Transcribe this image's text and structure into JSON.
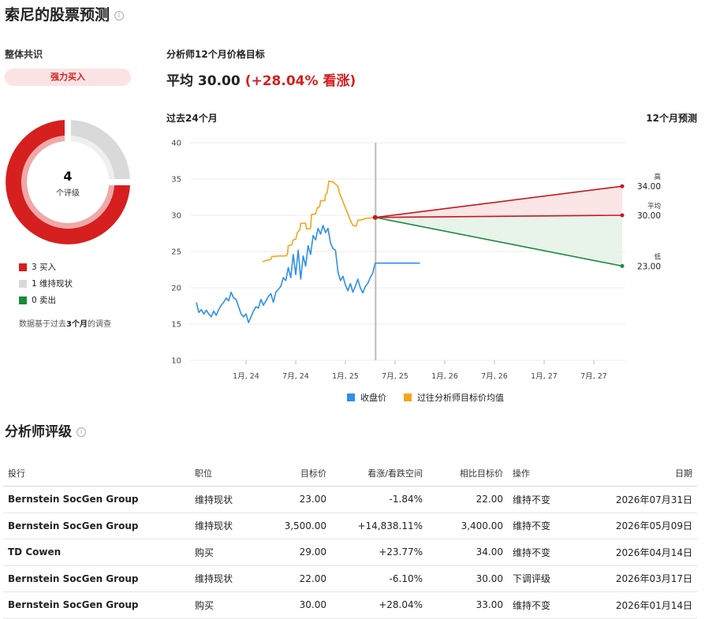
{
  "page": {
    "title": "索尼的股票预测"
  },
  "consensus": {
    "label": "整体共识",
    "badge": "强力买入",
    "total": "4",
    "total_label": "个评级",
    "legend": [
      {
        "label": "3 买入",
        "color": "#d61f1f"
      },
      {
        "label": "1 维持现状",
        "color": "#d9d9d9"
      },
      {
        "label": "0 卖出",
        "color": "#1a8a3a"
      }
    ],
    "note_prefix": "数据基于过去",
    "note_bold": "3个月",
    "note_suffix": "的调查"
  },
  "target": {
    "label": "分析师12个月价格目标",
    "avg_text": "平均 30.00",
    "avg_pct": "(+28.04% 看涨)",
    "past_label": "过去24个月",
    "future_label": "12个月预测"
  },
  "chart_data": {
    "type": "line",
    "ylim": [
      10,
      40
    ],
    "yticks": [
      10,
      15,
      20,
      25,
      30,
      35,
      40
    ],
    "xticks": [
      "1月, 24",
      "7月, 24",
      "1月, 25",
      "7月, 25",
      "1月, 26",
      "7月, 26",
      "1月, 27",
      "7月, 27"
    ],
    "legend": [
      {
        "name": "收盘价",
        "color": "#2f8fe8"
      },
      {
        "name": "过往分析师目标价均值",
        "color": "#f4a51c"
      }
    ],
    "forecast": {
      "start": 29.7,
      "high": {
        "label": "高",
        "value": "34.00",
        "num": 34.0
      },
      "avg": {
        "label": "平均",
        "value": "30.00",
        "num": 30.0
      },
      "low": {
        "label": "低",
        "value": "23.00",
        "num": 23.0
      },
      "colors": {
        "high": "#c8161e",
        "avg": "#c8161e",
        "low": "#1a8a3a"
      }
    },
    "series": [
      {
        "name": "收盘价",
        "points": [
          [
            0,
            18
          ],
          [
            0.3,
            16.6
          ],
          [
            0.6,
            17.0
          ],
          [
            0.9,
            16.4
          ],
          [
            1.2,
            16.9
          ],
          [
            1.5,
            16.4
          ],
          [
            1.8,
            16.0
          ],
          [
            2.1,
            16.8
          ],
          [
            2.4,
            16.2
          ],
          [
            2.7,
            17.0
          ],
          [
            3.0,
            17.6
          ],
          [
            3.3,
            18.0
          ],
          [
            3.6,
            18.6
          ],
          [
            3.9,
            18.2
          ],
          [
            4.2,
            19.4
          ],
          [
            4.5,
            18.6
          ],
          [
            4.8,
            18.4
          ],
          [
            5.1,
            17.4
          ],
          [
            5.4,
            16.4
          ],
          [
            5.7,
            16.0
          ],
          [
            6.0,
            16.4
          ],
          [
            6.3,
            15.2
          ],
          [
            6.6,
            16.0
          ],
          [
            6.9,
            16.8
          ],
          [
            7.2,
            17.4
          ],
          [
            7.5,
            17.2
          ],
          [
            7.8,
            18.4
          ],
          [
            8.1,
            17.6
          ],
          [
            8.4,
            18.2
          ],
          [
            8.7,
            18.8
          ],
          [
            9.0,
            19.2
          ],
          [
            9.3,
            18.0
          ],
          [
            9.6,
            19.4
          ],
          [
            9.9,
            19.8
          ],
          [
            10.2,
            20.2
          ],
          [
            10.5,
            21.4
          ],
          [
            10.8,
            21.0
          ],
          [
            11.1,
            22.8
          ],
          [
            11.4,
            21.4
          ],
          [
            11.7,
            24.6
          ],
          [
            12.0,
            21.8
          ],
          [
            12.3,
            25.2
          ],
          [
            12.6,
            21.2
          ],
          [
            12.9,
            24.4
          ],
          [
            13.2,
            23.0
          ],
          [
            13.5,
            25.8
          ],
          [
            13.8,
            24.6
          ],
          [
            14.1,
            27.2
          ],
          [
            14.4,
            26.6
          ],
          [
            14.7,
            28.2
          ],
          [
            15.0,
            27.4
          ],
          [
            15.3,
            28.6
          ],
          [
            15.6,
            27.6
          ],
          [
            15.9,
            28.2
          ],
          [
            16.2,
            26.2
          ],
          [
            16.5,
            25.4
          ],
          [
            16.8,
            25.2
          ],
          [
            17.1,
            22.2
          ],
          [
            17.4,
            21.0
          ],
          [
            17.7,
            21.6
          ],
          [
            18.0,
            20.4
          ],
          [
            18.3,
            19.6
          ],
          [
            18.6,
            20.6
          ],
          [
            18.9,
            19.4
          ],
          [
            19.2,
            20.2
          ],
          [
            19.5,
            21.2
          ],
          [
            19.8,
            20.0
          ],
          [
            20.1,
            19.3
          ],
          [
            20.4,
            20.2
          ],
          [
            20.7,
            20.6
          ],
          [
            21.0,
            21.4
          ],
          [
            21.3,
            22.0
          ],
          [
            21.6,
            23.4
          ],
          [
            22.0,
            23.4
          ],
          [
            23.0,
            23.4
          ],
          [
            24.0,
            23.4
          ],
          [
            25.0,
            23.4
          ],
          [
            26.0,
            23.4
          ],
          [
            27.0,
            23.4
          ]
        ]
      },
      {
        "name": "过往分析师目标价均值",
        "points": [
          [
            8.0,
            23.6
          ],
          [
            8.5,
            23.8
          ],
          [
            9.0,
            23.9
          ],
          [
            9.1,
            24.3
          ],
          [
            10.0,
            24.4
          ],
          [
            10.8,
            24.4
          ],
          [
            11.0,
            24.6
          ],
          [
            11.1,
            25.8
          ],
          [
            11.5,
            25.9
          ],
          [
            11.7,
            26.6
          ],
          [
            12.0,
            26.7
          ],
          [
            12.2,
            27.6
          ],
          [
            12.5,
            28.0
          ],
          [
            12.6,
            28.9
          ],
          [
            13.2,
            28.9
          ],
          [
            13.3,
            28.1
          ],
          [
            13.8,
            28.2
          ],
          [
            13.9,
            30.1
          ],
          [
            14.4,
            30.2
          ],
          [
            14.6,
            31.0
          ],
          [
            14.9,
            31.2
          ],
          [
            15.0,
            32.0
          ],
          [
            15.5,
            32.0
          ],
          [
            15.6,
            32.8
          ],
          [
            15.8,
            33.1
          ],
          [
            16.0,
            34.7
          ],
          [
            16.5,
            34.6
          ],
          [
            16.8,
            34.3
          ],
          [
            17.1,
            34.0
          ],
          [
            17.3,
            33.0
          ],
          [
            17.6,
            32.2
          ],
          [
            18.0,
            31.0
          ],
          [
            18.3,
            30.2
          ],
          [
            18.6,
            29.3
          ],
          [
            18.9,
            28.6
          ],
          [
            19.3,
            28.5
          ],
          [
            19.5,
            29.3
          ],
          [
            20.1,
            29.4
          ],
          [
            20.5,
            29.6
          ],
          [
            21.0,
            29.6
          ],
          [
            21.3,
            29.7
          ],
          [
            21.6,
            29.7
          ]
        ]
      }
    ]
  },
  "ratings": {
    "title": "分析师评级",
    "headers": [
      "投行",
      "职位",
      "目标价",
      "看涨/看跌空间",
      "相比目标价",
      "操作",
      "日期"
    ],
    "rows": [
      {
        "firm": "Bernstein SocGen Group",
        "position": "维持现状",
        "position_type": "hold",
        "target": "23.00",
        "upside": "-1.84%",
        "upside_type": "neg",
        "prev": "22.00",
        "action": "维持不变",
        "date": "2026年07月31日"
      },
      {
        "firm": "Bernstein SocGen Group",
        "position": "维持现状",
        "position_type": "hold",
        "target": "3,500.00",
        "upside": "+14,838.11%",
        "upside_type": "pos",
        "prev": "3,400.00",
        "action": "维持不变",
        "date": "2026年05月09日"
      },
      {
        "firm": "TD Cowen",
        "position": "购买",
        "position_type": "buy",
        "target": "29.00",
        "upside": "+23.77%",
        "upside_type": "pos",
        "prev": "34.00",
        "action": "维持不变",
        "date": "2026年04月14日"
      },
      {
        "firm": "Bernstein SocGen Group",
        "position": "维持现状",
        "position_type": "hold",
        "target": "22.00",
        "upside": "-6.10%",
        "upside_type": "neg",
        "prev": "30.00",
        "action": "下调评级",
        "date": "2026年03月17日"
      },
      {
        "firm": "Bernstein SocGen Group",
        "position": "购买",
        "position_type": "buy",
        "target": "30.00",
        "upside": "+28.04%",
        "upside_type": "pos",
        "prev": "33.00",
        "action": "维持不变",
        "date": "2026年01月14日"
      }
    ]
  }
}
